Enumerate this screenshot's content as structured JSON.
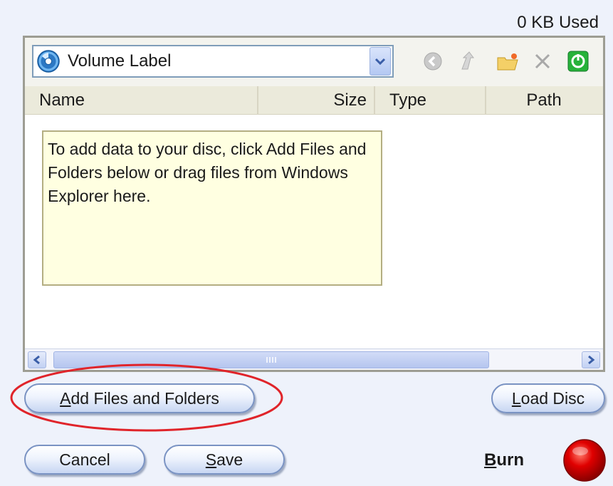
{
  "usage": "0 KB Used",
  "toolbar": {
    "volume_label": "Volume Label",
    "icons": [
      "back-icon",
      "up-folder-icon",
      "new-folder-icon",
      "delete-icon",
      "power-icon"
    ]
  },
  "columns": {
    "name": "Name",
    "size": "Size",
    "type": "Type",
    "path": "Path"
  },
  "tip": "To add data to your disc, click Add Files and Folders below or drag files from Windows Explorer here.",
  "buttons": {
    "add_prefix": "",
    "add_mnemonic": "A",
    "add_rest": "dd Files and Folders",
    "load_mnemonic": "L",
    "load_rest": "oad Disc",
    "cancel": "Cancel",
    "save_mnemonic": "S",
    "save_rest": "ave",
    "burn_mnemonic": "B",
    "burn_rest": "urn"
  },
  "colors": {
    "highlight": "#e0242a",
    "burn": "#e00000",
    "tip_bg": "#ffffe1"
  }
}
